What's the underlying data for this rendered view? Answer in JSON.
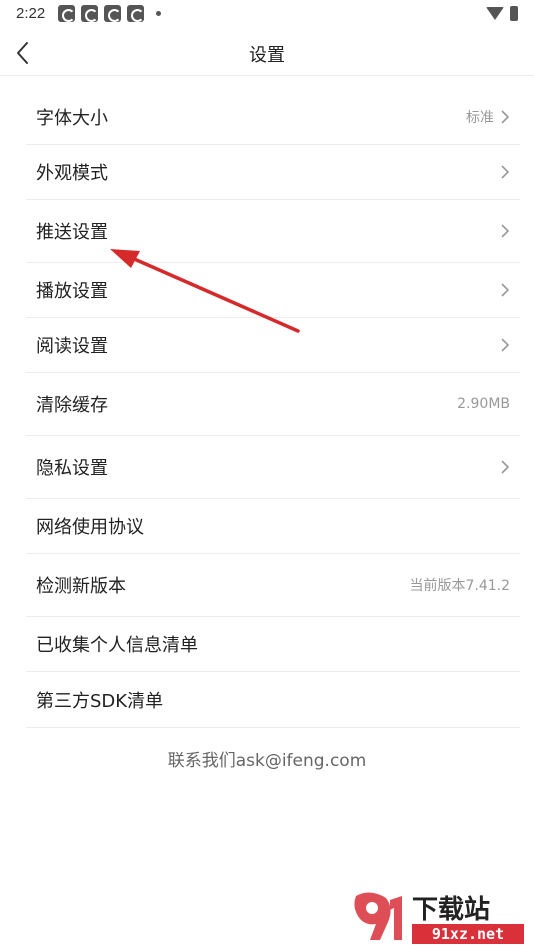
{
  "status_bar": {
    "time": "2:22"
  },
  "header": {
    "title": "设置"
  },
  "settings": {
    "font_size": {
      "label": "字体大小",
      "value": "标准"
    },
    "appearance": {
      "label": "外观模式"
    },
    "push": {
      "label": "推送设置"
    },
    "playback": {
      "label": "播放设置"
    },
    "reading": {
      "label": "阅读设置"
    },
    "clear_cache": {
      "label": "清除缓存",
      "value": "2.90MB"
    },
    "privacy": {
      "label": "隐私设置"
    },
    "network_agreement": {
      "label": "网络使用协议"
    },
    "check_update": {
      "label": "检测新版本",
      "value": "当前版本7.41.2"
    },
    "collected_info": {
      "label": "已收集个人信息清单"
    },
    "third_party_sdk": {
      "label": "第三方SDK清单"
    }
  },
  "footer": {
    "contact": "联系我们ask@ifeng.com"
  },
  "watermark": {
    "logo_text": "下载站",
    "domain": "91xz.net"
  },
  "colors": {
    "annotation_arrow": "#d62a2a",
    "divider": "#ececec",
    "secondary_text": "#999999"
  }
}
